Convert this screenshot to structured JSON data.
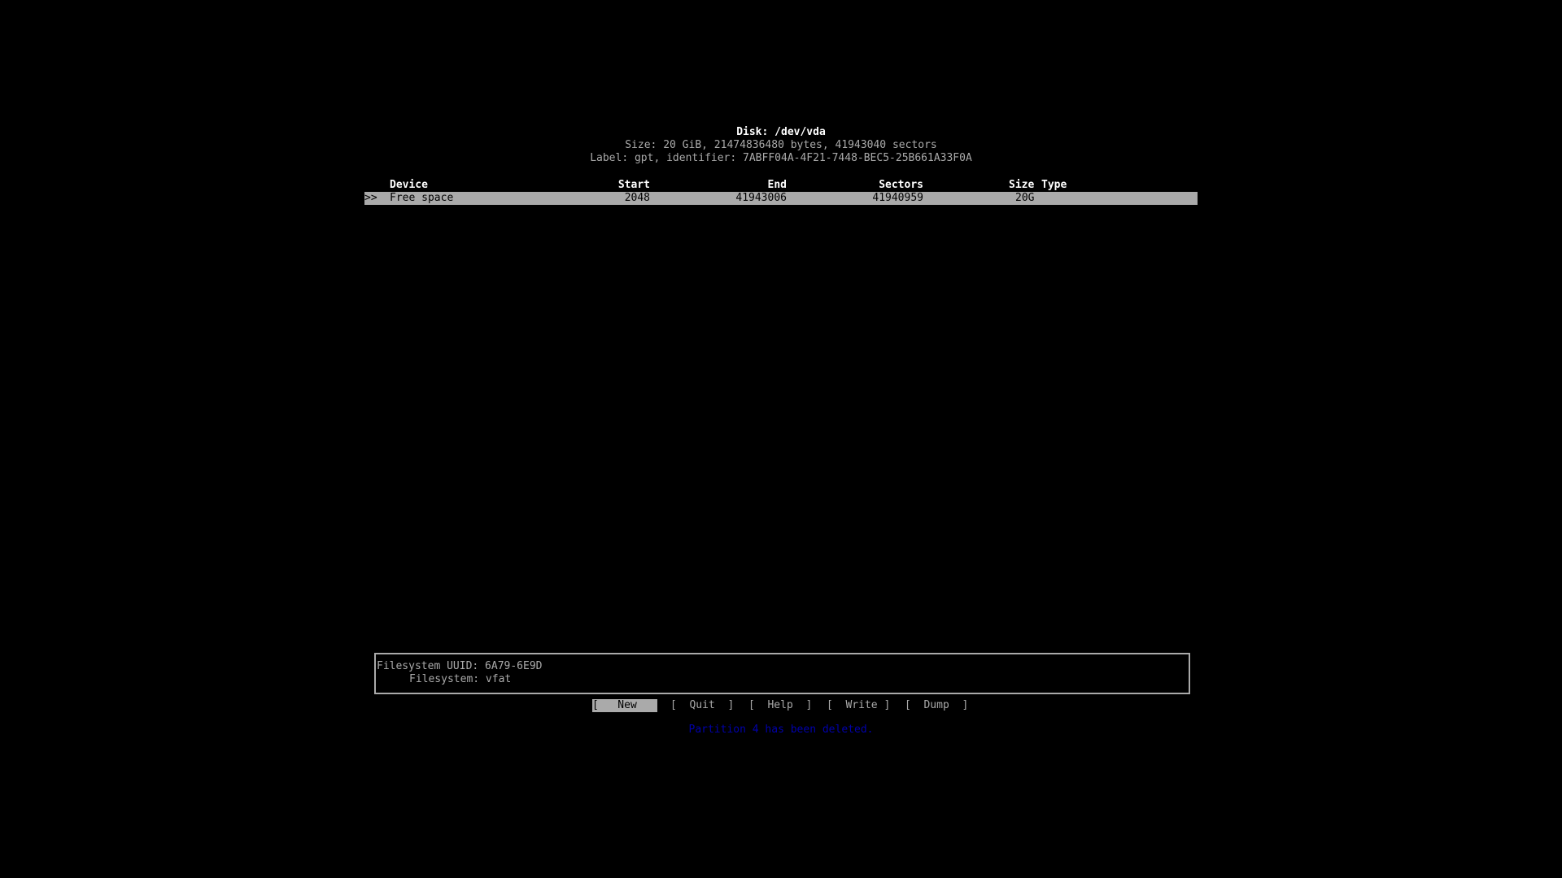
{
  "disk": {
    "title": "Disk: /dev/vda",
    "size_line": "Size: 20 GiB, 21474836480 bytes, 41943040 sectors",
    "label_line": "Label: gpt, identifier: 7ABFF04A-4F21-7448-BEC5-25B661A33F0A"
  },
  "table": {
    "headers": {
      "device": "Device",
      "start": "Start",
      "end": "End",
      "sectors": "Sectors",
      "size": "Size",
      "type": "Type"
    },
    "rows": [
      {
        "marker": ">>",
        "device": "Free space",
        "start": "2048",
        "end": "41943006",
        "sectors": "41940959",
        "size": "20G",
        "type": ""
      }
    ]
  },
  "info": {
    "uuid_line": "Filesystem UUID: 6A79-6E9D",
    "fs_line": "Filesystem: vfat"
  },
  "buttons": [
    {
      "label": "[   New   ]",
      "active": true
    },
    {
      "label": "[  Quit  ]"
    },
    {
      "label": "[  Help  ]"
    },
    {
      "label": "[  Write ]"
    },
    {
      "label": "[  Dump  ]"
    }
  ],
  "status": "Partition 4 has been deleted.",
  "colors": {
    "highlight": "#aaaaaa",
    "status": "#0000aa",
    "text": "#aaaaaa"
  }
}
